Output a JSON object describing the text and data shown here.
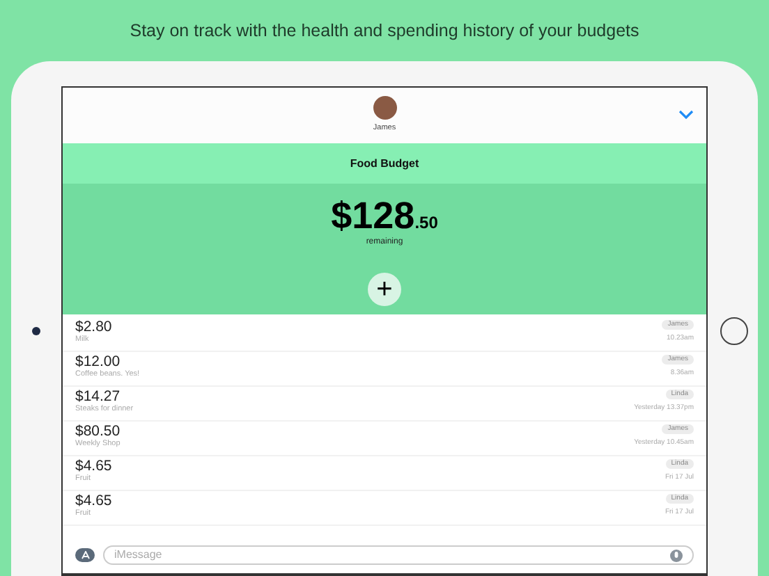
{
  "headline": "Stay on track with the health and spending history of your budgets",
  "header": {
    "contact_name": "James"
  },
  "budget": {
    "title": "Food Budget",
    "amount_main": "$128",
    "amount_cents": ".50",
    "remaining_label": "remaining",
    "add_label": "+"
  },
  "transactions": [
    {
      "amount": "$2.80",
      "note": "Milk",
      "person": "James",
      "time": "10.23am"
    },
    {
      "amount": "$12.00",
      "note": "Coffee beans. Yes!",
      "person": "James",
      "time": "8.36am"
    },
    {
      "amount": "$14.27",
      "note": "Steaks for dinner",
      "person": "Linda",
      "time": "Yesterday 13.37pm"
    },
    {
      "amount": "$80.50",
      "note": "Weekly Shop",
      "person": "James",
      "time": "Yesterday 10.45am"
    },
    {
      "amount": "$4.65",
      "note": "Fruit",
      "person": "Linda",
      "time": "Fri 17 Jul"
    },
    {
      "amount": "$4.65",
      "note": "Fruit",
      "person": "Linda",
      "time": "Fri 17 Jul"
    }
  ],
  "message_field": {
    "placeholder": "iMessage"
  }
}
